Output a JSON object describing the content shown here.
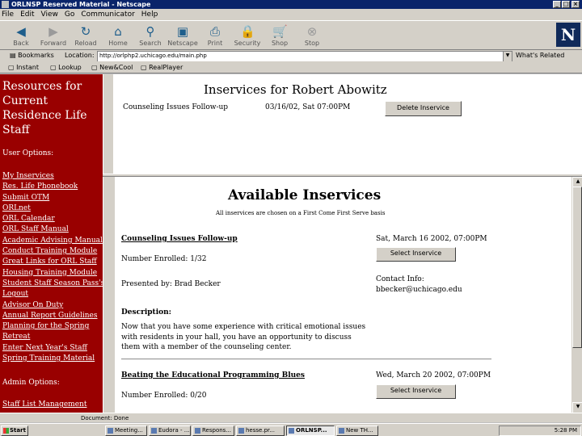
{
  "window": {
    "title": "ORLNSP Reserved Material - Netscape"
  },
  "menu": [
    "File",
    "Edit",
    "View",
    "Go",
    "Communicator",
    "Help"
  ],
  "toolbar": {
    "buttons": [
      {
        "label": "Back",
        "icon": "back-arrow-icon"
      },
      {
        "label": "Forward",
        "icon": "forward-arrow-icon"
      },
      {
        "label": "Reload",
        "icon": "reload-icon"
      },
      {
        "label": "Home",
        "icon": "home-icon"
      },
      {
        "label": "Search",
        "icon": "search-icon"
      },
      {
        "label": "Netscape",
        "icon": "netscape-icon"
      },
      {
        "label": "Print",
        "icon": "print-icon"
      },
      {
        "label": "Security",
        "icon": "security-icon"
      },
      {
        "label": "Shop",
        "icon": "shop-icon"
      },
      {
        "label": "Stop",
        "icon": "stop-icon"
      }
    ],
    "logo": "N"
  },
  "location": {
    "bookmarks": "Bookmarks",
    "label": "Location:",
    "url": "http://orlphp2.uchicago.edu/main.php",
    "related": "What's Related"
  },
  "personal": [
    "Instant",
    "Lookup",
    "New&Cool",
    "RealPlayer"
  ],
  "left": {
    "title": "Resources for Current Residence Life Staff",
    "user_options": "User Options:",
    "links": [
      "My Inservices",
      "Res. Life Phonebook",
      "Submit OTM",
      "ORLnet",
      "ORL Calendar",
      "ORL Staff Manual",
      "Academic Advising Manual",
      "Conduct Training Module",
      "Great Links for ORL Staff",
      "Housing Training Module",
      "Student Staff Season Pass's",
      "Logout",
      "Advisor On Duty",
      "Annual Report Guidelines",
      "Planning for the Spring",
      "Retreat",
      "Enter Next Year's Staff",
      "Spring Training Material"
    ],
    "admin_options": "Admin Options:",
    "admin_link": "Staff List Management"
  },
  "my_inservices": {
    "heading": "Inservices for Robert Abowitz",
    "rows": [
      {
        "name": "Counseling Issues Follow-up",
        "date": "03/16/02, Sat 07:00PM",
        "button": "Delete Inservice"
      }
    ]
  },
  "available": {
    "heading": "Available Inservices",
    "subtitle": "All inservices are chosen on a First Come First Serve basis",
    "events": [
      {
        "title": "Counseling Issues Follow-up",
        "date": "Sat, March 16 2002, 07:00PM",
        "button": "Select Inservice",
        "enrolled": "Number Enrolled: 1/32",
        "presenter": "Presented by: Brad Becker",
        "contact_label": "Contact Info:",
        "contact": "bbecker@uchicago.edu",
        "desc_label": "Description:",
        "desc": "Now that you have some experience with critical emotional issues with residents in your hall, you have an opportunity to discuss them with a member of the counseling center."
      },
      {
        "title": "Beating the Educational Programming Blues",
        "date": "Wed, March 20 2002, 07:00PM",
        "button": "Select Inservice",
        "enrolled": "Number Enrolled: 0/20"
      }
    ]
  },
  "status": "Document: Done",
  "taskbar": {
    "start": "Start",
    "tasks": [
      "Meeting...",
      "Eudora - ...",
      "Respons...",
      "hesse.pr...",
      "ORLNSP...",
      "New TH..."
    ],
    "clock": "5:28 PM"
  }
}
